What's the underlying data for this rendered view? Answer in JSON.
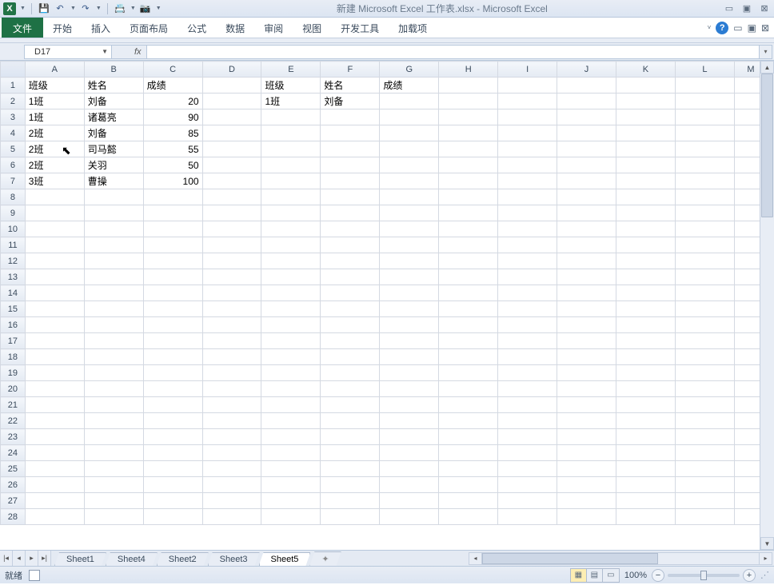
{
  "title": "新建 Microsoft Excel 工作表.xlsx - Microsoft Excel",
  "ribbon": {
    "file": "文件",
    "tabs": [
      "开始",
      "插入",
      "页面布局",
      "公式",
      "数据",
      "审阅",
      "视图",
      "开发工具",
      "加载项"
    ]
  },
  "namebox": "D17",
  "columns": [
    "A",
    "B",
    "C",
    "D",
    "E",
    "F",
    "G",
    "H",
    "I",
    "J",
    "K",
    "L",
    "M"
  ],
  "rows": 28,
  "cells": {
    "A1": "班级",
    "B1": "姓名",
    "C1": "成绩",
    "E1": "班级",
    "F1": "姓名",
    "G1": "成绩",
    "A2": "1班",
    "B2": "刘备",
    "C2": "20",
    "E2": "1班",
    "F2": "刘备",
    "A3": "1班",
    "B3": "诸葛亮",
    "C3": "90",
    "A4": "2班",
    "B4": "刘备",
    "C4": "85",
    "A5": "2班",
    "B5": "司马懿",
    "C5": "55",
    "A6": "2班",
    "B6": "关羽",
    "C6": "50",
    "A7": "3班",
    "B7": "曹操",
    "C7": "100"
  },
  "numeric_cols": [
    "C"
  ],
  "sheets": [
    "Sheet1",
    "Sheet4",
    "Sheet2",
    "Sheet3",
    "Sheet5"
  ],
  "active_sheet": "Sheet5",
  "status": "就绪",
  "zoom": "100%"
}
